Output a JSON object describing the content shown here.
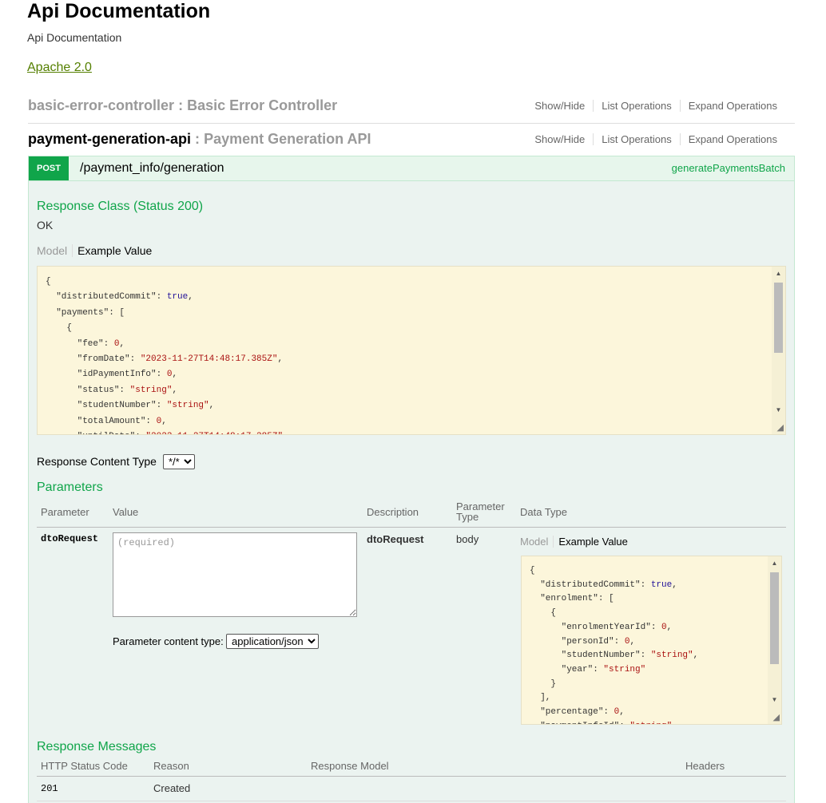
{
  "info": {
    "title": "Api Documentation",
    "description": "Api Documentation",
    "license": "Apache 2.0"
  },
  "resources": [
    {
      "name": "basic-error-controller",
      "separator": ":",
      "description": "Basic Error Controller",
      "options": [
        "Show/Hide",
        "List Operations",
        "Expand Operations"
      ]
    },
    {
      "name": "payment-generation-api",
      "separator": ":",
      "description": "Payment Generation API",
      "options": [
        "Show/Hide",
        "List Operations",
        "Expand Operations"
      ]
    }
  ],
  "operation": {
    "method": "POST",
    "path": "/payment_info/generation",
    "nickname": "generatePaymentsBatch",
    "response_class_title": "Response Class (Status 200)",
    "response_class_text": "OK",
    "model_tab": "Model",
    "example_tab": "Example Value",
    "response_content_type_label": "Response Content Type",
    "response_content_type_value": "*/*",
    "parameters_title": "Parameters",
    "param_headers": {
      "parameter": "Parameter",
      "value": "Value",
      "description": "Description",
      "parameter_type": "Parameter Type",
      "data_type": "Data Type"
    },
    "param": {
      "name": "dtoRequest",
      "placeholder": "(required)",
      "description": "dtoRequest",
      "type": "body",
      "content_type_label": "Parameter content type:",
      "content_type_value": "application/json"
    },
    "response_messages_title": "Response Messages",
    "resp_headers": {
      "code": "HTTP Status Code",
      "reason": "Reason",
      "model": "Response Model",
      "headers": "Headers"
    },
    "responses": [
      {
        "code": "201",
        "reason": "Created"
      }
    ]
  },
  "colors": {
    "accent_green": "#10a54a",
    "op_background": "#ebf3f0",
    "code_background": "#fcf6db",
    "license_link": "#547f00"
  }
}
